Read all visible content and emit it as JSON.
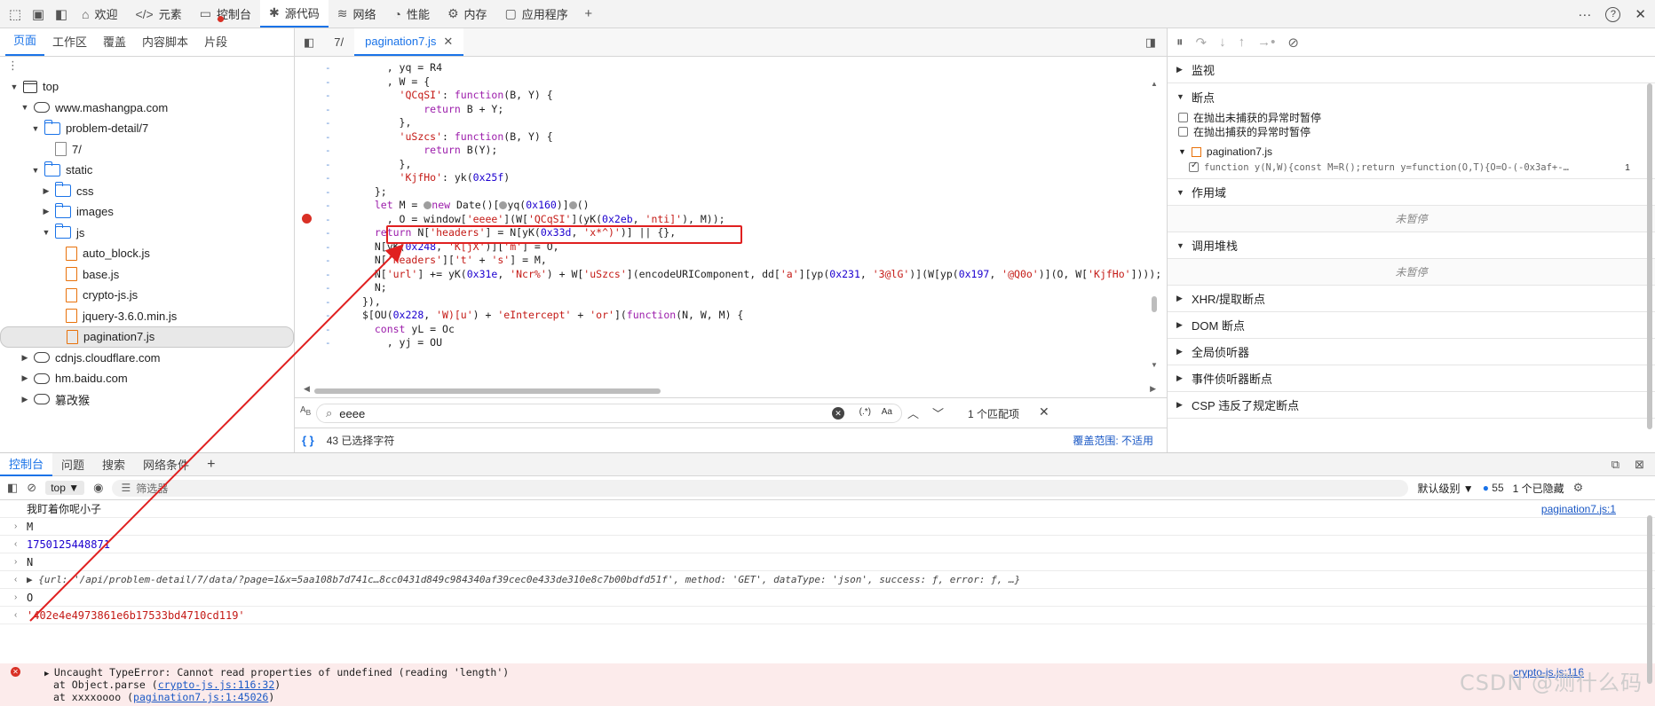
{
  "topbar": {
    "tabs": [
      {
        "label": "欢迎",
        "icon": "home-icon"
      },
      {
        "label": "元素",
        "icon": "code-icon"
      },
      {
        "label": "控制台",
        "icon": "console-icon"
      },
      {
        "label": "源代码",
        "icon": "bug-icon"
      },
      {
        "label": "网络",
        "icon": "wifi-icon"
      },
      {
        "label": "性能",
        "icon": "performance-icon"
      },
      {
        "label": "内存",
        "icon": "gear-icon"
      },
      {
        "label": "应用程序",
        "icon": "application-icon"
      }
    ],
    "add": "+",
    "more": "···",
    "help": "?",
    "close": "✕"
  },
  "left": {
    "tabs": [
      "页面",
      "工作区",
      "覆盖",
      "内容脚本",
      "片段"
    ],
    "tree": [
      {
        "label": "top",
        "icon": "frame",
        "indent": 0,
        "caret": "▼"
      },
      {
        "label": "www.mashangpa.com",
        "icon": "cloud",
        "indent": 1,
        "caret": "▼"
      },
      {
        "label": "problem-detail/7",
        "icon": "folder",
        "indent": 2,
        "caret": "▼"
      },
      {
        "label": "7/",
        "icon": "filegray",
        "indent": 3,
        "caret": ""
      },
      {
        "label": "static",
        "icon": "folder",
        "indent": 2,
        "caret": "▼"
      },
      {
        "label": "css",
        "icon": "folder",
        "indent": 3,
        "caret": "▶"
      },
      {
        "label": "images",
        "icon": "folder",
        "indent": 3,
        "caret": "▶"
      },
      {
        "label": "js",
        "icon": "folder",
        "indent": 3,
        "caret": "▼"
      },
      {
        "label": "auto_block.js",
        "icon": "file",
        "indent": 4,
        "caret": ""
      },
      {
        "label": "base.js",
        "icon": "file",
        "indent": 4,
        "caret": ""
      },
      {
        "label": "crypto-js.js",
        "icon": "file",
        "indent": 4,
        "caret": ""
      },
      {
        "label": "jquery-3.6.0.min.js",
        "icon": "file",
        "indent": 4,
        "caret": ""
      },
      {
        "label": "pagination7.js",
        "icon": "file",
        "indent": 4,
        "caret": "",
        "selected": true
      },
      {
        "label": "cdnjs.cloudflare.com",
        "icon": "cloud",
        "indent": 1,
        "caret": "▶"
      },
      {
        "label": "hm.baidu.com",
        "icon": "cloud",
        "indent": 1,
        "caret": "▶"
      },
      {
        "label": "篡改猴",
        "icon": "cloud",
        "indent": 1,
        "caret": "▶"
      }
    ]
  },
  "editor": {
    "tabs": [
      "7/",
      "pagination7.js"
    ],
    "lines": [
      "    , yq = R4",
      "    , W = {",
      "      'QCqSI': function(B, Y) {",
      "          return B + Y;",
      "      },",
      "      'uSzcs': function(B, Y) {",
      "          return B(Y);",
      "      },",
      "      'KjfHo': yk(0x25f)",
      "  };",
      "  let M = ●new Date()[●yq(0x160)]●()",
      "    , O = window['eeee'](W['QCqSI'](yK(0x2eb, 'nti]'), M));",
      "  return N['headers'] = N[yK(0x33d, 'x*^)')] || {},",
      "  N[yK(0x248, 'K[jX')]['m'] = O,",
      "  N['headers']['t' + 's'] = M,",
      "  N['url'] += yK(0x31e, 'Ncr%') + W['uSzcs'](encodeURIComponent, dd['a'][yp(0x231, '3@lG')](W[yp(0x197, '@Q0o')](O, W['KjfHo'])));",
      "  N;",
      "}),",
      "$[OU(0x228, 'W)[u') + 'eIntercept' + 'or'](function(N, W, M) {",
      "  const yL = Oc",
      "    , yj = OU"
    ],
    "search_value": "eeee",
    "search_regex": "(.*)",
    "search_case": "Aa",
    "match_count": "1 个匹配项",
    "status_left": "43 已选择字符",
    "status_right": "覆盖范围: 不适用",
    "status_braces": "{ }"
  },
  "right": {
    "sections": {
      "watch": "监视",
      "breakpoints": "断点",
      "cb1": "在抛出未捕获的异常时暂停",
      "cb2": "在抛出捕获的异常时暂停",
      "bp_file": "pagination7.js",
      "bp_code": "function y(N,W){const M=R();return y=function(O,T){O=O-(-0x3af+-…",
      "bp_line": "1",
      "scope": "作用域",
      "not_paused": "未暂停",
      "callstack": "调用堆栈",
      "not_paused2": "未暂停",
      "xhr": "XHR/提取断点",
      "dom": "DOM 断点",
      "global": "全局侦听器",
      "event": "事件侦听器断点",
      "csp": "CSP 违反了规定断点"
    }
  },
  "drawer": {
    "tabs": [
      "控制台",
      "问题",
      "搜索",
      "网络条件"
    ],
    "context": "top",
    "filter_placeholder": "筛选器",
    "level": "默认级别",
    "issues": "55",
    "hidden": "1 个已隐藏",
    "rows": [
      {
        "arrow": "",
        "text": "我盯着你呢小子",
        "link": "pagination7.js:1"
      },
      {
        "arrow": "›",
        "text": "M",
        "link": ""
      },
      {
        "arrow": "‹",
        "text": "1750125448871",
        "link": ""
      },
      {
        "arrow": "›",
        "text": "N",
        "link": ""
      },
      {
        "arrow": "‹",
        "text": "▶ {url: '/api/problem-detail/7/data/?page=1&x=5aa108b7d741c…8cc0431d849c984340af39cec0e433de310e8c7b00bdfd51f', method: 'GET', dataType: 'json', success: ƒ, error: ƒ, …}",
        "link": ""
      },
      {
        "arrow": "›",
        "text": "O",
        "link": ""
      },
      {
        "arrow": "‹",
        "text": "'402e4e4973861e6b17533bd4710cd119'",
        "link": ""
      }
    ],
    "error": {
      "title": "Uncaught TypeError: Cannot read properties of undefined (reading 'length')",
      "line1_pre": "at Object.parse (",
      "line1_link": "crypto-js.js:116:32",
      "line2_pre": "at xxxxoooo (",
      "line2_link": "pagination7.js:1:45026",
      "link": "crypto-js.js:116"
    }
  },
  "watermark": "CSDN @测什么码"
}
